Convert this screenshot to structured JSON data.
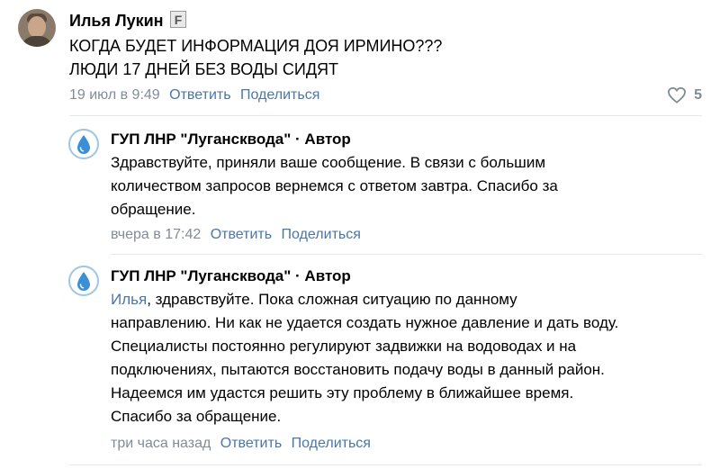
{
  "comment": {
    "author": "Илья Лукин",
    "badge": "F",
    "lines": [
      "КОГДА БУДЕТ ИНФОРМАЦИЯ ДОЯ ИРМИНО???",
      "ЛЮДИ 17 ДНЕЙ БЕЗ ВОДЫ СИДЯТ"
    ],
    "time": "19 июл в 9:49",
    "reply_label": "Ответить",
    "share_label": "Поделиться",
    "likes": "5",
    "like_icon": "heart-icon"
  },
  "replies": [
    {
      "author": "ГУП ЛНР \"Лугансквода\"",
      "role": " · Автор",
      "avatar_icon": "water-drop-icon",
      "lines": [
        "Здравствуйте, приняли ваше сообщение. В связи с большим",
        "количеством запросов вернемся с ответом завтра. Спасибо за",
        "обращение."
      ],
      "time": "вчера в 17:42",
      "reply_label": "Ответить",
      "share_label": "Поделиться"
    },
    {
      "author": "ГУП ЛНР \"Лугансквода\"",
      "role": " · Автор",
      "avatar_icon": "water-drop-icon",
      "mention": "Илья",
      "first_line_rest": ", здравствуйте. Пока сложная ситуацию по данному",
      "lines": [
        "направлению. Ни как не удается создать нужное давление и дать воду.",
        "Специалисты постоянно регулируют задвижки на водоводах и на",
        "подключениях, пытаются восстановить подачу воды в данный район.",
        "Надеемся им удастся решить эту проблему в ближайшее время.",
        "Спасибо за обращение."
      ],
      "time": "три часа назад",
      "reply_label": "Ответить",
      "share_label": "Поделиться"
    }
  ],
  "colors": {
    "link": "#4a76a8",
    "meta": "#818c99",
    "separator": "#e7e8ec"
  }
}
